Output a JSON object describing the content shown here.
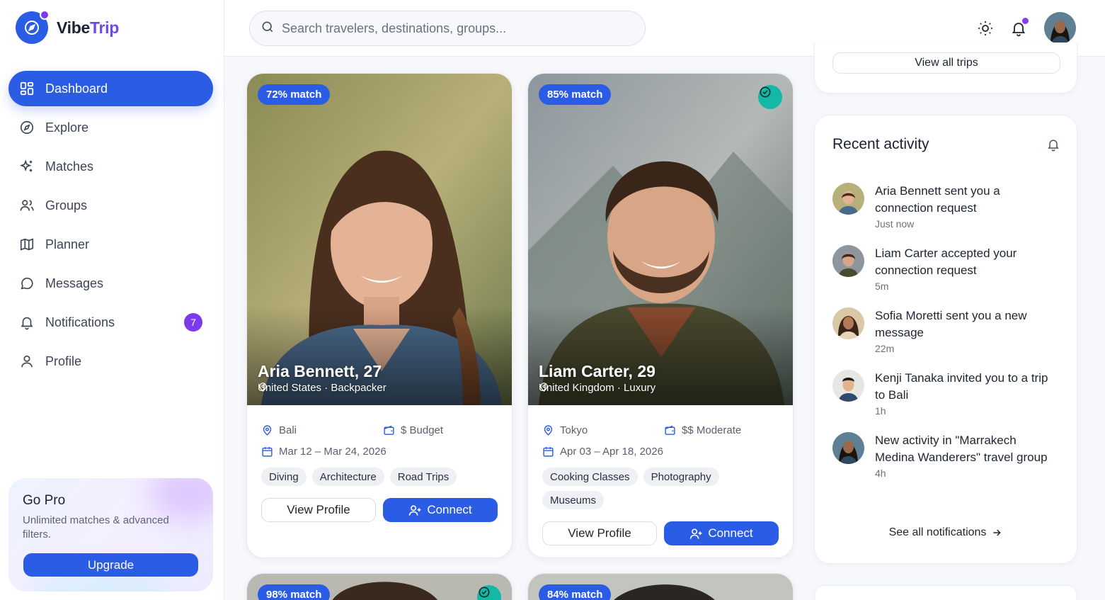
{
  "app": {
    "name_a": "Vibe",
    "name_b": "Trip"
  },
  "search": {
    "placeholder": "Search travelers, destinations, groups..."
  },
  "nav": [
    {
      "label": "Dashboard",
      "icon": "grid-icon",
      "active": true
    },
    {
      "label": "Explore",
      "icon": "compass-icon"
    },
    {
      "label": "Matches",
      "icon": "sparkles-icon"
    },
    {
      "label": "Groups",
      "icon": "users-icon"
    },
    {
      "label": "Planner",
      "icon": "map-icon"
    },
    {
      "label": "Messages",
      "icon": "chat-icon"
    },
    {
      "label": "Notifications",
      "icon": "bell-icon",
      "badge": "7"
    },
    {
      "label": "Profile",
      "icon": "user-icon"
    }
  ],
  "gopro": {
    "title": "Go Pro",
    "text": "Unlimited matches & advanced filters.",
    "button": "Upgrade"
  },
  "cards": [
    {
      "match": "72% match",
      "verified": false,
      "name": "Aria Bennett, 27",
      "location": "United States · Backpacker",
      "destination": "Bali",
      "budget": "$ Budget",
      "dates": "Mar 12 – Mar 24, 2026",
      "tags": [
        "Diving",
        "Architecture",
        "Road Trips"
      ],
      "view_label": "View Profile",
      "connect_label": "Connect"
    },
    {
      "match": "85% match",
      "verified": true,
      "name": "Liam Carter, 29",
      "location": "United Kingdom · Luxury",
      "destination": "Tokyo",
      "budget": "$$ Moderate",
      "dates": "Apr 03 – Apr 18, 2026",
      "tags": [
        "Cooking Classes",
        "Photography",
        "Museums"
      ],
      "view_label": "View Profile",
      "connect_label": "Connect"
    },
    {
      "match": "98% match",
      "verified": true
    },
    {
      "match": "84% match",
      "verified": false
    }
  ],
  "trips": {
    "view_all": "View all trips"
  },
  "activity": {
    "title": "Recent activity",
    "items": [
      {
        "text": "Aria Bennett sent you a connection request",
        "time": "Just now"
      },
      {
        "text": "Liam Carter accepted your connection request",
        "time": "5m"
      },
      {
        "text": "Sofia Moretti sent you a new message",
        "time": "22m"
      },
      {
        "text": "Kenji Tanaka invited you to a trip to Bali",
        "time": "1h"
      },
      {
        "text": "New activity in \"Marrakech Medina Wanderers\" travel group",
        "time": "4h"
      }
    ],
    "see_all": "See all notifications"
  },
  "colors": {
    "accent": "#2b5ce6",
    "purple": "#7c3aed",
    "teal": "#14b8a6"
  }
}
